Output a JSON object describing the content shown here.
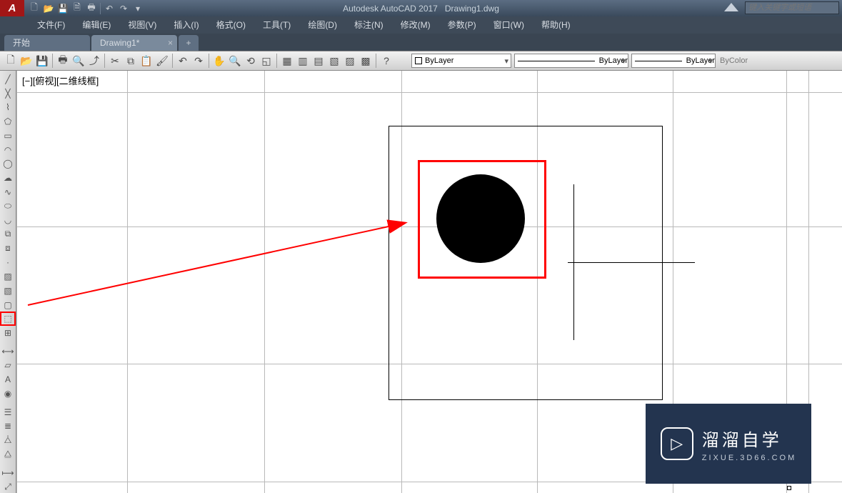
{
  "titlebar": {
    "app_logo_text": "A",
    "app_name": "Autodesk AutoCAD 2017",
    "doc_name": "Drawing1.dwg",
    "search_placeholder": "键入关键字或短语",
    "qat": [
      "new",
      "open",
      "save",
      "saveas",
      "plot",
      "undo",
      "redo"
    ]
  },
  "menubar": {
    "items": [
      {
        "label": "文件(F)"
      },
      {
        "label": "编辑(E)"
      },
      {
        "label": "视图(V)"
      },
      {
        "label": "插入(I)"
      },
      {
        "label": "格式(O)"
      },
      {
        "label": "工具(T)"
      },
      {
        "label": "绘图(D)"
      },
      {
        "label": "标注(N)"
      },
      {
        "label": "修改(M)"
      },
      {
        "label": "参数(P)"
      },
      {
        "label": "窗口(W)"
      },
      {
        "label": "帮助(H)"
      }
    ]
  },
  "tabs": {
    "start_label": "开始",
    "doc_label": "Drawing1*",
    "add_glyph": "+"
  },
  "toolbar": {
    "layer_select_label": "ByLayer",
    "linetype_select_label": "ByLayer",
    "lineweight_select_label": "ByLayer",
    "bycolor_label": "ByColor"
  },
  "viewport": {
    "label": "[−][俯视][二维线框]"
  },
  "watermark": {
    "cn": "溜溜自学",
    "en": "ZIXUE.3D66.COM"
  },
  "left_toolbar_icons": [
    "line",
    "construction-line",
    "polyline",
    "polygon",
    "rectangle",
    "arc",
    "circle",
    "revcloud",
    "spline",
    "ellipse",
    "ellipse-arc",
    "insert-block",
    "make-block",
    "point",
    "hatch",
    "gradient",
    "region",
    "table",
    "text",
    "divider",
    "add-selected",
    "measure",
    "dim",
    "dimcon",
    "divider",
    "dim-linear",
    "dim-aligned"
  ]
}
